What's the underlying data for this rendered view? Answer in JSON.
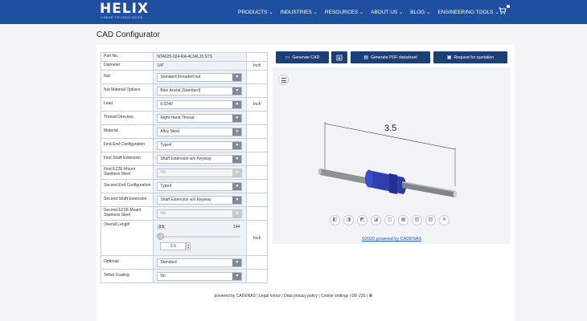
{
  "nav": {
    "logo": "HELIX",
    "tagline": "LINEAR TECHNOLOGIES",
    "items": [
      {
        "label": "PRODUCTS"
      },
      {
        "label": "INDUSTRIES"
      },
      {
        "label": "RESOURCES"
      },
      {
        "label": "ABOUT US"
      },
      {
        "label": "BLOG"
      },
      {
        "label": "ENGINEERING TOOLS"
      }
    ],
    "chevron": "⌄"
  },
  "page_title": "CAD Configurator",
  "config": {
    "part_no_label": "Part No.",
    "part_no_value": "NTA025-024-RA-4L34LJ3 STS",
    "diameter_label": "Diameter",
    "diameter_value": "1/4\"",
    "diameter_unit": "Inch",
    "nut_label": "Nut",
    "nut_value": "Standard threaded nut",
    "nut_material_label": "Nut Material Options",
    "nut_material_value": "Blue Acetal (Standard)",
    "lead_label": "Lead",
    "lead_value": "0.0240",
    "lead_unit": "Inch",
    "thread_direction_label": "Thread Direction",
    "thread_direction_value": "Right Hand Thread",
    "material_label": "Material",
    "material_value": "Alloy Steel",
    "first_end_label": "First End Configuration",
    "first_end_value": "Type4",
    "first_shaft_label": "First Shaft Extension",
    "first_shaft_value": "Shaft Extension w/o Keyway",
    "first_ez2e_label": "First EZ2E-Mount Stainless Steel",
    "first_ez2e_value": "NA",
    "second_end_label": "Second End Configuration",
    "second_end_value": "Type4",
    "second_shaft_label": "Second Shaft Extension",
    "second_shaft_value": "Shaft Extension w/o Keyway",
    "second_ez2e_label": "Second EZ2E-Mount Stainless Steel",
    "second_ez2e_value": "NA",
    "overall_length_label": "Overall Length",
    "overall_length_min": "3.5",
    "overall_length_max": "144",
    "overall_length_value": "3.5",
    "overall_length_unit": "Inch",
    "optional_label": "Optional",
    "optional_value": "Standard",
    "teflon_label": "Teflon Coating",
    "teflon_value": "No",
    "dropdown_arrow": "▼"
  },
  "buttons": {
    "generate_cad": "Generate CAD",
    "generate_pdf": "Generate PDF datasheet",
    "request_quotation": "Request for quotation"
  },
  "viewer": {
    "dimension_label": "3.5",
    "powered_by": "©2020 powered by CADENAS"
  },
  "footer": {
    "text": "powered by CADENAS | Legal notice | Data privacy policy | Cookie settings | DE-225 |"
  },
  "colors": {
    "nav_bg": "#1f4fa0",
    "button_bg": "#1d3f78",
    "link": "#1f5fb8",
    "nut_blue": "#2f3fb0"
  }
}
